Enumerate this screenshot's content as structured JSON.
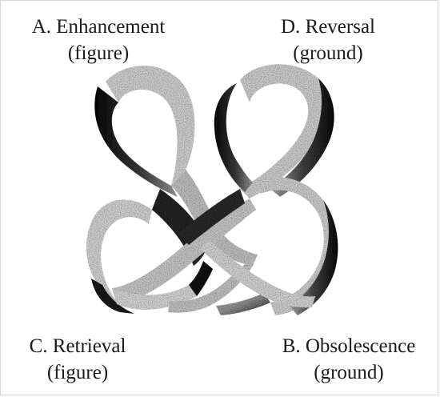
{
  "diagram": {
    "labels": {
      "a": {
        "title": "A. Enhancement",
        "subtitle": "(figure)"
      },
      "d": {
        "title": "D. Reversal",
        "subtitle": "(ground)"
      },
      "c": {
        "title": "C. Retrieval",
        "subtitle": "(figure)"
      },
      "b": {
        "title": "B. Obsolescence",
        "subtitle": "(ground)"
      }
    },
    "colors": {
      "band_light": "#cfcfcf",
      "band_dark": "#111111",
      "text": "#1a1a1a",
      "background": "#ffffff"
    }
  }
}
